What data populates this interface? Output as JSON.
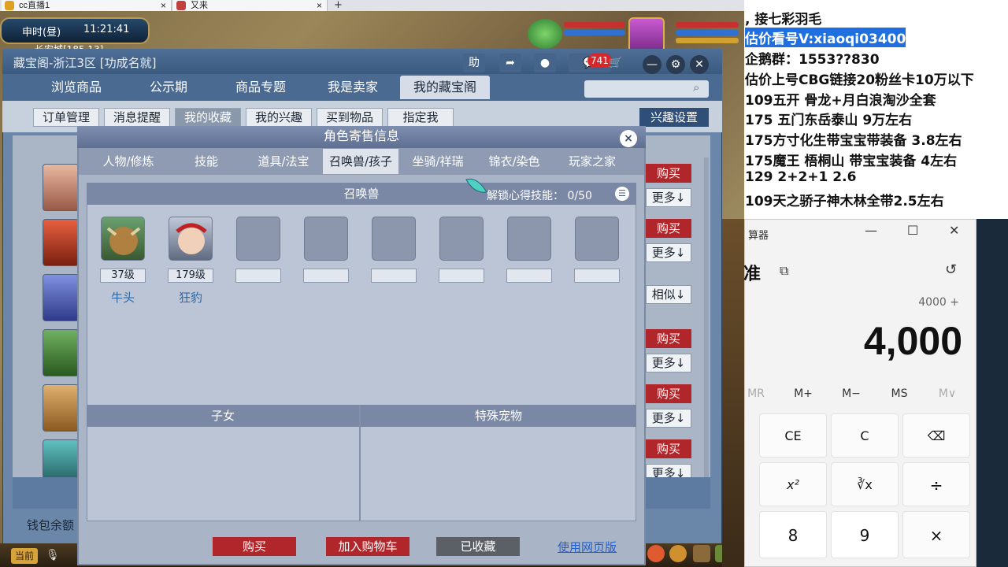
{
  "browser_tabs": [
    {
      "title": "cc直播1",
      "close": "×"
    },
    {
      "title": "又来",
      "close": "×"
    }
  ],
  "game": {
    "time_label": "申时(昼)",
    "clock": "11:21:41",
    "map_label": "长安城[185,13]",
    "current_btn": "当前"
  },
  "window": {
    "title": "藏宝阁-浙江3区 [功成名就]",
    "help": "助",
    "msg_count": "741",
    "nav_tabs": [
      "浏览商品",
      "公示期",
      "商品专题",
      "我是卖家",
      "我的藏宝阁"
    ],
    "sub_tabs": [
      "订单管理",
      "消息提醒",
      "我的收藏",
      "我的兴趣",
      "买到物品",
      "指定我"
    ],
    "interest_btn": "兴趣设置",
    "buy_label": "购买",
    "more_label": "更多↓",
    "similar_label": "相似↓",
    "wallet_label": "钱包余额"
  },
  "dialog": {
    "title": "角色寄售信息",
    "close": "×",
    "tabs": [
      "人物/修炼",
      "技能",
      "道具/法宝",
      "召唤兽/孩子",
      "坐骑/祥瑞",
      "锦衣/染色",
      "玩家之家"
    ],
    "summon_header": "召唤兽",
    "unlock_label": "解锁心得技能：",
    "unlock_count": "0/50",
    "pets": [
      {
        "level": "37级",
        "name": "牛头"
      },
      {
        "level": "179级",
        "name": "狂豹"
      }
    ],
    "children_header": "子女",
    "special_header": "特殊宠物",
    "btn_buy": "购买",
    "btn_cart": "加入购物车",
    "btn_fav": "已收藏",
    "btn_web": "使用网页版"
  },
  "notes": [
    ",       接七彩羽毛",
    "估价看号V:xiaoqi03400",
    "企鹅群：1553??830",
    "估价上号CBG链接20粉丝卡10万以下",
    "109五开 骨龙+月白浪淘沙全套",
    "175 五门东岳泰山  9万左右",
    "175方寸化生带宝宝带装备  3.8左右",
    "175魔王 梧桐山  带宝宝装备 4左右",
    "129 2+2+1  2.6",
    "109天之骄子神木林全带2.5左右"
  ],
  "calculator": {
    "title": "算器",
    "mode": "准",
    "expression": "4000 +",
    "display": "4,000",
    "memory": [
      "MR",
      "M+",
      "M−",
      "MS",
      "M∨"
    ],
    "keys_row1": [
      "CE",
      "C",
      "⌫"
    ],
    "keys_row2": [
      "x²",
      "∛x",
      "÷"
    ],
    "keys_row3": [
      "8",
      "9",
      "×"
    ],
    "minimize": "—",
    "maximize": "☐",
    "close": "✕"
  },
  "colors": {
    "buy_red": "#b0262a",
    "fav_gray": "#5b5f66",
    "highlight_blue": "#1f6fe0"
  }
}
